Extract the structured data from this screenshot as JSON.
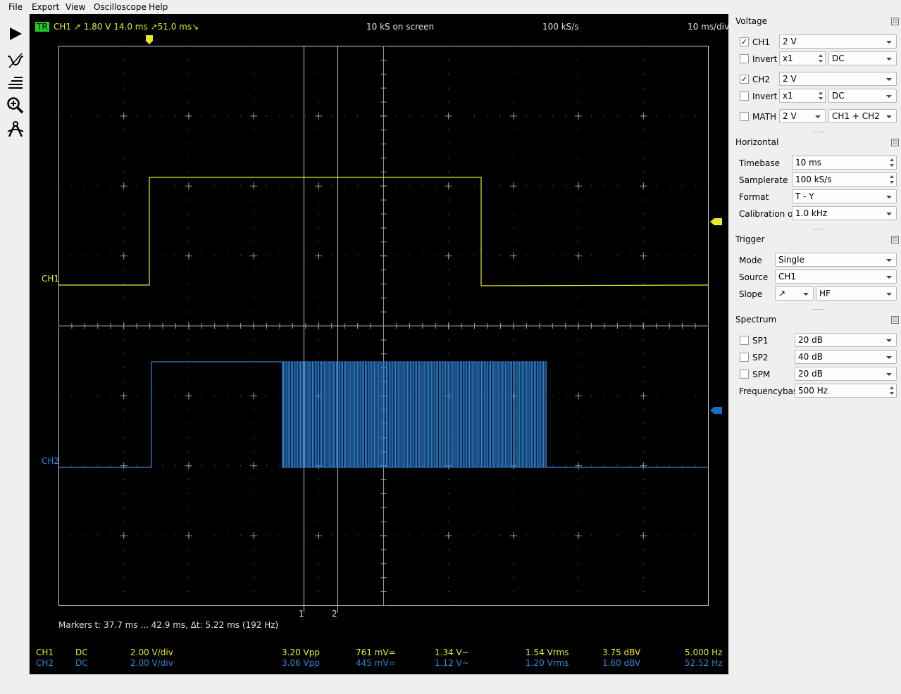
{
  "menu": [
    "File",
    "Export",
    "View",
    "Oscilloscope",
    "Help"
  ],
  "toolbar": [
    "play-icon",
    "waveform-icon",
    "list-icon",
    "zoom-icon",
    "measure-icon"
  ],
  "scope": {
    "tr_badge": "TR",
    "trigger_info": "CH1  ↗  1.80 V   14.0 ms  ↗51.0 ms↘",
    "samples_on_screen": "10 kS on screen",
    "samplerate": "100 kS/s",
    "timebase": "10 ms/div",
    "ch1_label": "CH1",
    "ch2_label": "CH2",
    "marker1": "1",
    "marker2": "2",
    "markers_text": "Markers    t: 37.7 ms ... 42.9 ms,   Δt: 5.22 ms (192 Hz)"
  },
  "measurements": {
    "ch1": {
      "name": "CH1",
      "coupling": "DC",
      "vdiv": "2.00 V/div",
      "vpp": "3.20 Vpp",
      "dc": "761 mV=",
      "ac": "1.34 V~",
      "rms": "1.54 Vrms",
      "dbv": "3.75 dBV",
      "freq": "5.000 Hz"
    },
    "ch2": {
      "name": "CH2",
      "coupling": "DC",
      "vdiv": "2.00 V/div",
      "vpp": "3.06 Vpp",
      "dc": "445 mV=",
      "ac": "1.12 V~",
      "rms": "1.20 Vrms",
      "dbv": "1.60 dBV",
      "freq": "52.52 Hz"
    }
  },
  "voltage": {
    "title": "Voltage",
    "ch1": {
      "label": "CH1",
      "checked": true,
      "gain": "2 V",
      "invert": "Invert",
      "probe": "x1",
      "coupling": "DC"
    },
    "ch2": {
      "label": "CH2",
      "checked": true,
      "gain": "2 V",
      "invert": "Invert",
      "probe": "x1",
      "coupling": "DC"
    },
    "math": {
      "label": "MATH",
      "checked": false,
      "gain": "2 V",
      "mode": "CH1 + CH2"
    }
  },
  "horizontal": {
    "title": "Horizontal",
    "timebase_label": "Timebase",
    "timebase": "10 ms",
    "samplerate_label": "Samplerate",
    "samplerate": "100 kS/s",
    "format_label": "Format",
    "format": "T - Y",
    "calibration_label": "Calibration out",
    "calibration": "1.0 kHz"
  },
  "trigger": {
    "title": "Trigger",
    "mode_label": "Mode",
    "mode": "Single",
    "source_label": "Source",
    "source": "CH1",
    "slope_label": "Slope",
    "slope": "↗",
    "filter": "HF"
  },
  "spectrum": {
    "title": "Spectrum",
    "sp1_label": "SP1",
    "sp1": "20 dB",
    "sp2_label": "SP2",
    "sp2": "40 dB",
    "spm_label": "SPM",
    "spm": "20 dB",
    "freqbase_label": "Frequencybase",
    "freqbase": "500 Hz"
  },
  "colors": {
    "ch1": "#e8e82c",
    "ch2": "#2f84d8",
    "grid": "#9a9a9a",
    "trigger_badge": "#22cc22"
  }
}
